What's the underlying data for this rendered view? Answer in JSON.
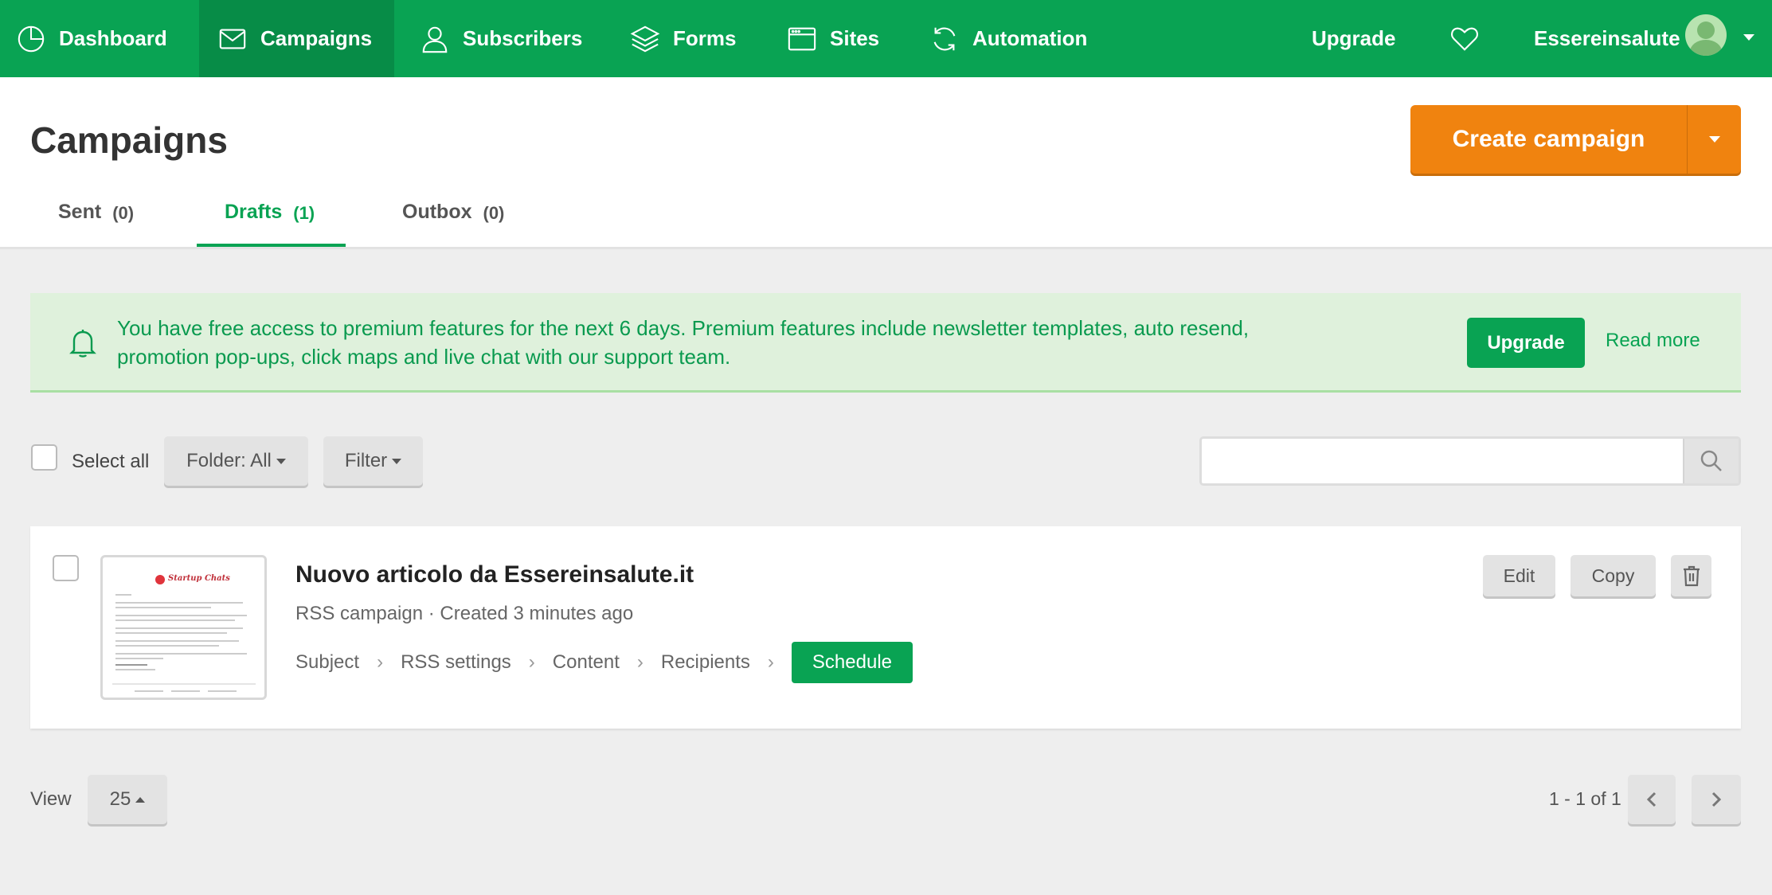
{
  "nav": {
    "items": [
      {
        "label": "Dashboard",
        "icon": "pie-chart-icon"
      },
      {
        "label": "Campaigns",
        "icon": "envelope-icon"
      },
      {
        "label": "Subscribers",
        "icon": "user-icon"
      },
      {
        "label": "Forms",
        "icon": "layers-icon"
      },
      {
        "label": "Sites",
        "icon": "browser-window-icon"
      },
      {
        "label": "Automation",
        "icon": "refresh-icon"
      }
    ],
    "upgrade": "Upgrade",
    "account": "Essereinsalute",
    "active": "Campaigns",
    "color": "#09a353"
  },
  "header": {
    "title": "Campaigns",
    "create_label": "Create campaign",
    "create_color": "#f0830f"
  },
  "tabs": [
    {
      "label": "Sent",
      "count": "(0)"
    },
    {
      "label": "Drafts",
      "count": "(1)",
      "active": true
    },
    {
      "label": "Outbox",
      "count": "(0)"
    }
  ],
  "alert": {
    "message": "You have free access to premium features for the next 6 days. Premium features include newsletter templates, auto resend, promotion pop-ups, click maps and live chat with our support team.",
    "upgrade": "Upgrade",
    "read_more": "Read more"
  },
  "toolbar": {
    "select_all": "Select all",
    "folder": "Folder: All",
    "filter": "Filter",
    "search_placeholder": ""
  },
  "campaign": {
    "title": "Nuovo articolo da Essereinsalute.it",
    "subtitle": "RSS campaign · Created 3 minutes ago",
    "steps": [
      "Subject",
      "RSS settings",
      "Content",
      "Recipients"
    ],
    "schedule": "Schedule",
    "thumbnail_brand": "Startup Chats",
    "actions": {
      "edit": "Edit",
      "copy": "Copy"
    }
  },
  "footer": {
    "view_label": "View",
    "per_page": "25",
    "range": "1 - 1 of 1"
  }
}
